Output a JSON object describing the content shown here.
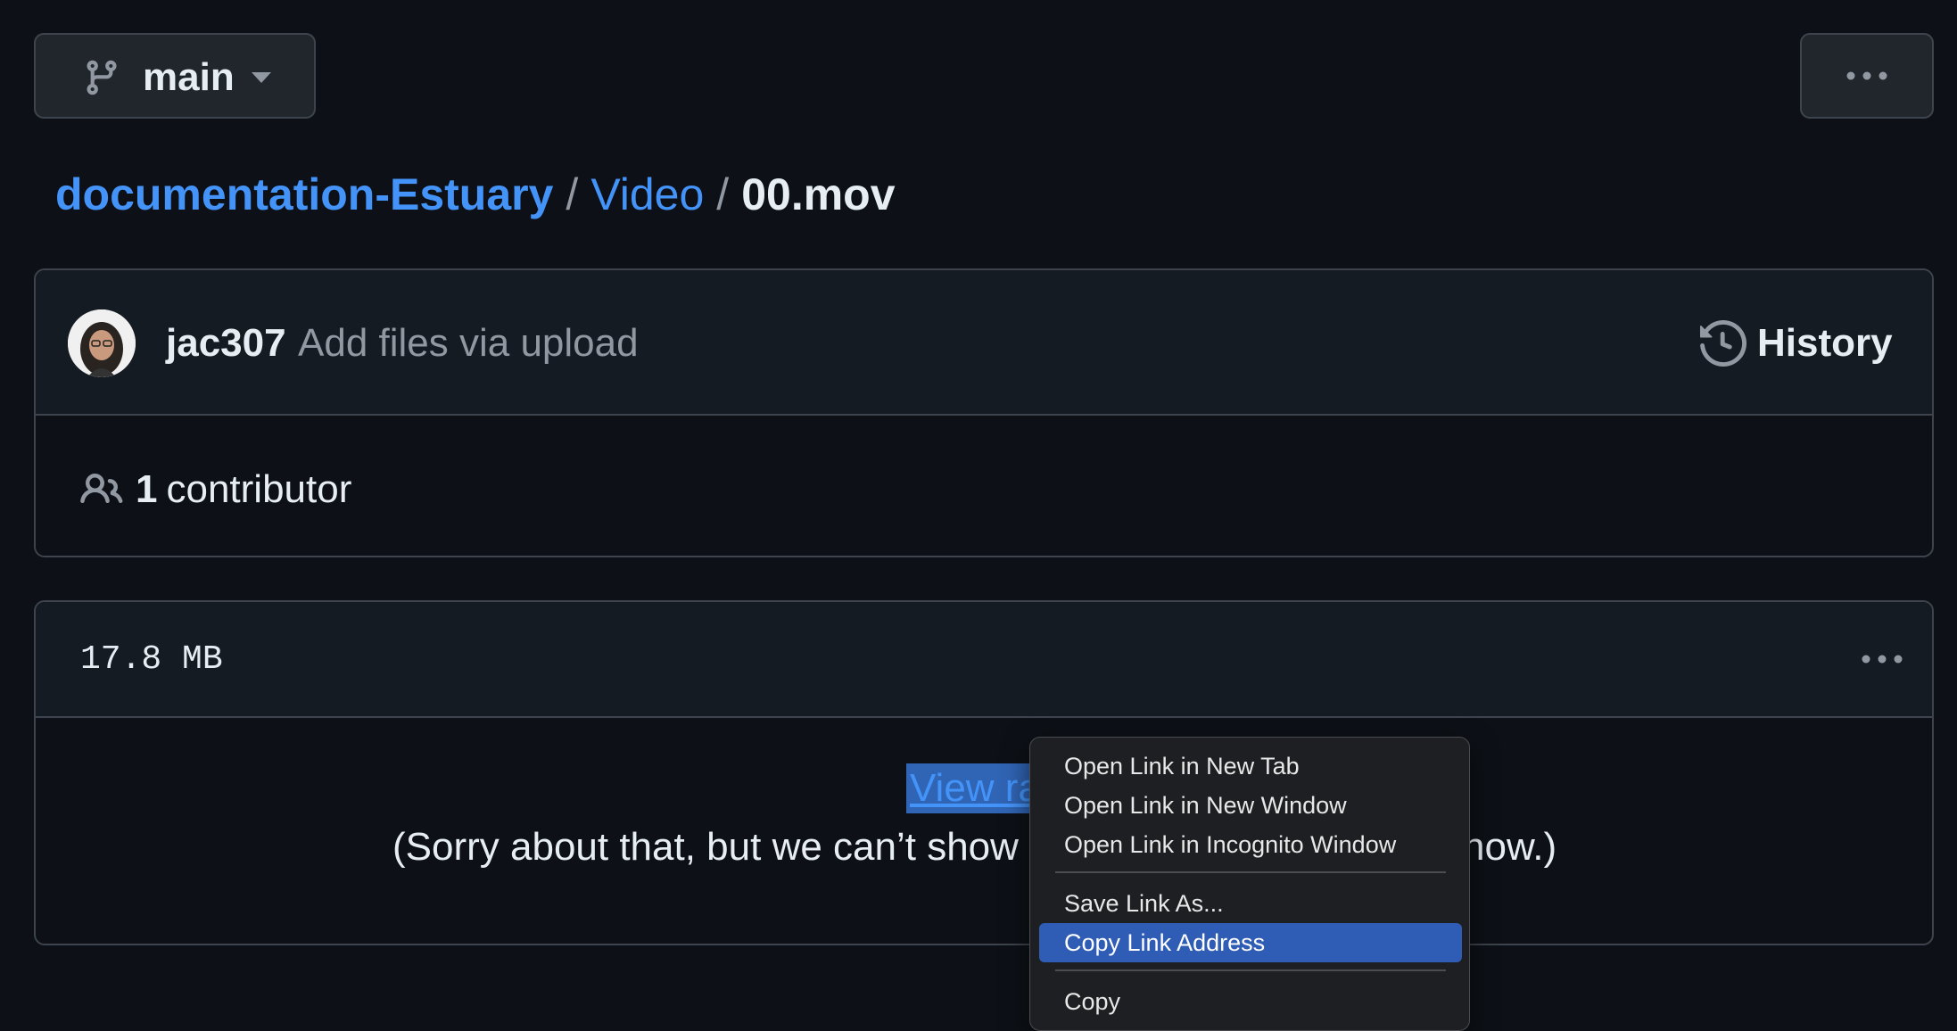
{
  "branch": {
    "name": "main"
  },
  "breadcrumb": {
    "repo": "documentation-Estuary",
    "folder": "Video",
    "file": "00.mov",
    "separator": "/"
  },
  "commit": {
    "author": "jac307",
    "message": "Add files via upload",
    "history_label": "History"
  },
  "contributors": {
    "count": "1",
    "label": "contributor"
  },
  "file": {
    "size": "17.8 MB",
    "view_raw_label": "View raw",
    "notice_visible_start": "(Sorry about that, but we can’t show",
    "notice_visible_end": "now.)"
  },
  "context_menu": {
    "items": [
      {
        "label": "Open Link in New Tab"
      },
      {
        "label": "Open Link in New Window"
      },
      {
        "label": "Open Link in Incognito Window"
      },
      {
        "label": "Save Link As..."
      },
      {
        "label": "Copy Link Address",
        "selected": true
      },
      {
        "label": "Copy"
      }
    ]
  },
  "colors": {
    "background": "#0d1117",
    "link": "#4493f8",
    "menu_highlight": "#2f5cb5",
    "border": "#3d444d"
  }
}
